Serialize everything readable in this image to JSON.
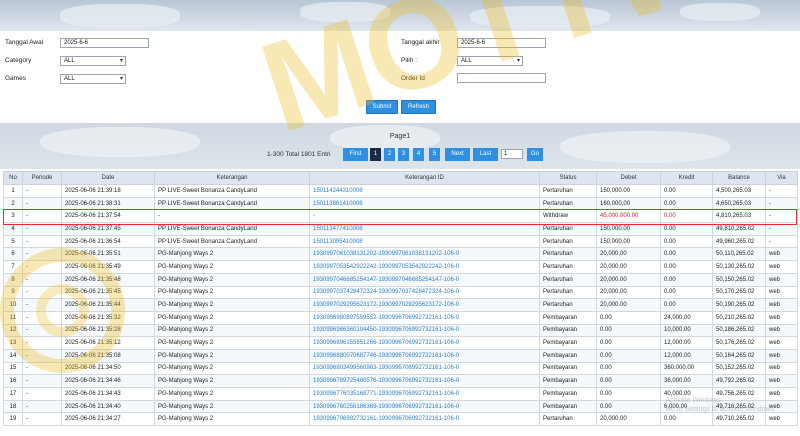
{
  "filters": {
    "tanggal_awal_label": "Tanggal Awal",
    "tanggal_awal_value": "2025-6-6",
    "tanggal_akhir_label": "Tanggal akhir",
    "tanggal_akhir_value": "2025-6-6",
    "category_label": "Category",
    "category_value": "ALL",
    "pilih_label": "Pilih :",
    "pilih_value": "ALL",
    "games_label": "Games",
    "games_value": "ALL",
    "order_id_label": "Order Id",
    "order_id_value": "",
    "submit_label": "Submit",
    "refresh_label": "Refresh"
  },
  "pagination": {
    "title": "Page1",
    "total_text": "1-300 Total 1801 Entri",
    "first_label": "First",
    "pages": [
      "1",
      "2",
      "3",
      "4",
      "5"
    ],
    "next_label": "Next",
    "last_label": "Last",
    "page_input_value": "1",
    "go_label": "Go"
  },
  "table": {
    "headers": [
      "No",
      "Periode",
      "Date",
      "Keterangan",
      "Keterangan ID",
      "Status",
      "Debet",
      "Kredit",
      "Balance",
      "Via"
    ],
    "rows": [
      [
        "1",
        "-",
        "2025-06-06 21:39:18",
        "PP LIVE-Sweet Bonanza CandyLand",
        "150114244310008",
        "Pertaruhan",
        "150,000.00",
        "0.00",
        "4,500,265.03",
        "-"
      ],
      [
        "2",
        "-",
        "2025-06-06 21:38:31",
        "PP LIVE-Sweet Bonanza CandyLand",
        "150113861410008",
        "Pertaruhan",
        "160,000.00",
        "0.00",
        "4,650,265.03",
        "-"
      ],
      [
        "3",
        "-",
        "2025-06-06 21:37:54",
        "-",
        "-",
        "Withdraw",
        "45,000,000.00",
        "0.00",
        "4,810,265.03",
        "-"
      ],
      [
        "4",
        "-",
        "2025-06-06 21:37:45",
        "PP LIVE-Sweet Bonanza CandyLand",
        "150113477410008",
        "Pertaruhan",
        "150,000.00",
        "0.00",
        "49,810,265.02",
        "-"
      ],
      [
        "5",
        "-",
        "2025-06-06 21:36:54",
        "PP LIVE-Sweet Bonanza CandyLand",
        "150113095410008",
        "Pertaruhan",
        "150,000.00",
        "0.00",
        "49,960,265.02",
        "-"
      ],
      [
        "6",
        "-",
        "2025-06-06 21:35:51",
        "PG-Mahjong Ways 2",
        "1930997061038131202-1930997061038131202-106-0",
        "Pertaruhan",
        "20,000.00",
        "0.00",
        "50,110,265.02",
        "web"
      ],
      [
        "7",
        "-",
        "2025-06-06 21:35:49",
        "PG-Mahjong Ways 2",
        "1930997053542922242-1930997053542922242-106-0",
        "Pertaruhan",
        "20,000.00",
        "0.00",
        "50,130,265.02",
        "web"
      ],
      [
        "8",
        "-",
        "2025-06-06 21:35:48",
        "PG-Mahjong Ways 2",
        "1930997046685254147-1930997046685254147-106-0",
        "Pertaruhan",
        "20,000.00",
        "0.00",
        "50,150,265.02",
        "web"
      ],
      [
        "9",
        "-",
        "2025-06-06 21:35:45",
        "PG-Mahjong Ways 2",
        "1930997037428472324-1930997037428472324-106-0",
        "Pertaruhan",
        "20,000.00",
        "0.00",
        "50,170,265.02",
        "web"
      ],
      [
        "10",
        "-",
        "2025-06-06 21:35:44",
        "PG-Mahjong Ways 2",
        "1930997029295623172-1930997029295623172-106-0",
        "Pertaruhan",
        "20,000.00",
        "0.00",
        "50,190,265.02",
        "web"
      ],
      [
        "11",
        "-",
        "2025-06-06 21:35:32",
        "PG-Mahjong Ways 2",
        "1930996980897559552-1930996706992732161-106-0",
        "Pembayaran",
        "0.00",
        "24,000.00",
        "50,210,265.02",
        "web"
      ],
      [
        "12",
        "-",
        "2025-06-06 21:35:28",
        "PG-Mahjong Ways 2",
        "1930996966360104450-1930996706992732161-106-0",
        "Pembayaran",
        "0.00",
        "10,000.00",
        "50,186,265.02",
        "web"
      ],
      [
        "13",
        "-",
        "2025-06-06 21:35:12",
        "PG-Mahjong Ways 2",
        "1930996896155851266-1930996706992732161-106-0",
        "Pembayaran",
        "0.00",
        "12,000.00",
        "50,176,265.02",
        "web"
      ],
      [
        "14",
        "-",
        "2025-06-06 21:35:08",
        "PG-Mahjong Ways 2",
        "1930996880070687746-1930996706992732161-106-0",
        "Pembayaran",
        "0.00",
        "12,000.00",
        "50,164,265.02",
        "web"
      ],
      [
        "15",
        "-",
        "2025-06-06 21:34:50",
        "PG-Mahjong Ways 2",
        "1930996803499560963-1930996706992732161-106-0",
        "Pembayaran",
        "0.00",
        "360,000.00",
        "50,152,265.02",
        "web"
      ],
      [
        "16",
        "-",
        "2025-06-06 21:34:46",
        "PG-Mahjong Ways 2",
        "1930996789725400576-1930996706992732161-106-0",
        "Pembayaran",
        "0.00",
        "36,000.00",
        "49,792,265.02",
        "web"
      ],
      [
        "17",
        "-",
        "2025-06-06 21:34:43",
        "PG-Mahjong Ways 2",
        "1930996776035168771-1930996706992732161-106-0",
        "Pembayaran",
        "0.00",
        "40,000.00",
        "49,756,265.02",
        "web"
      ],
      [
        "18",
        "-",
        "2025-06-06 21:34:40",
        "PG-Mahjong Ways 2",
        "1930996760256186369-1930996706992732161-106-0",
        "Pembayaran",
        "0.00",
        "6,000.00",
        "49,716,265.02",
        "web"
      ],
      [
        "19",
        "-",
        "2025-06-06 21:34:27",
        "PG-Mahjong Ways 2",
        "1930996706992732161-1930996706992732161-106-0",
        "Pertaruhan",
        "20,000.00",
        "0.00",
        "49,710,265.02",
        "web"
      ]
    ]
  },
  "watermark": {
    "text": "MOTTWIK"
  },
  "os_overlay": {
    "line1": "Activate Windows",
    "line2": "Go to Settings to activate Windows."
  },
  "colors": {
    "accent": "#2f8fe0",
    "active_page": "#1b2a44",
    "highlight": "#e03030",
    "link": "#2a7fd4"
  }
}
